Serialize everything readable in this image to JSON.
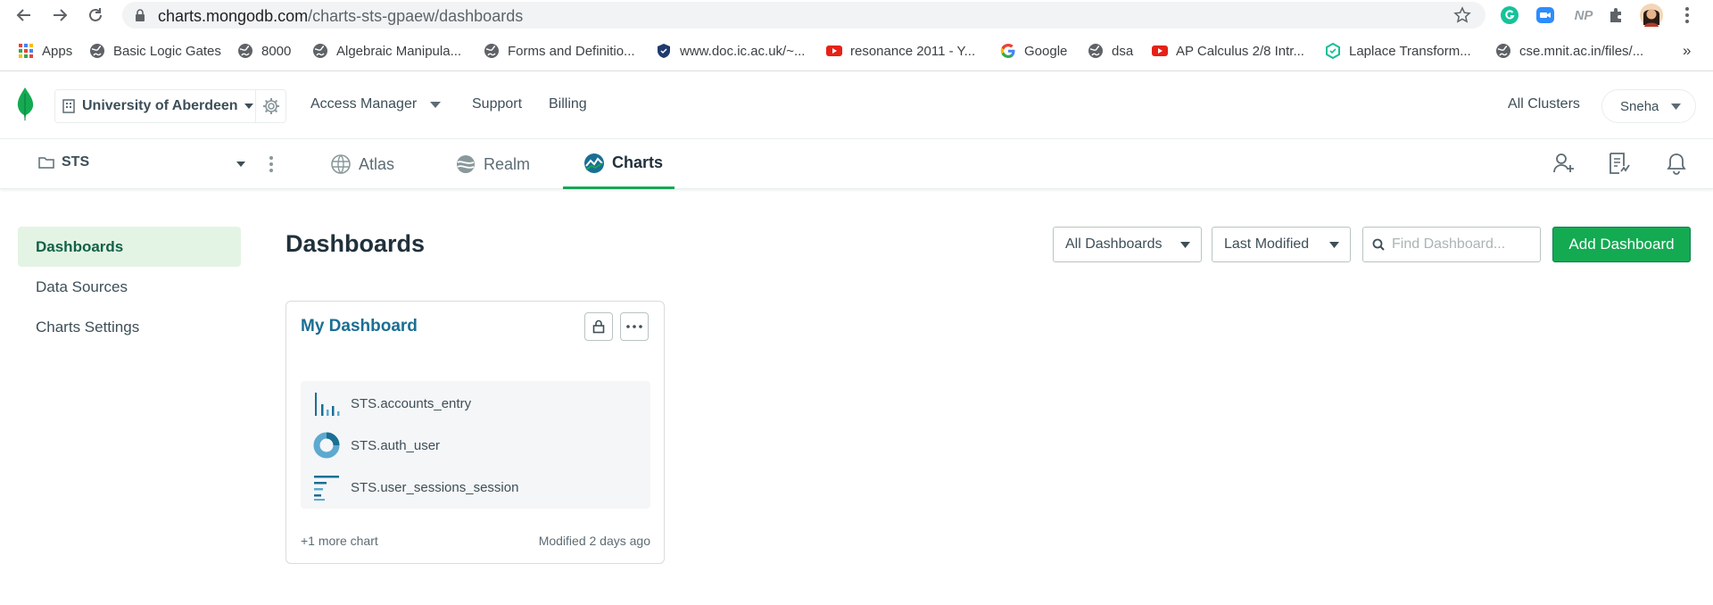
{
  "browser": {
    "url_host": "charts.mongodb.com",
    "url_path": "/charts-sts-gpaew/dashboards",
    "extension_np_label": "NP"
  },
  "bookmarks": {
    "apps": "Apps",
    "items": [
      {
        "label": "Basic Logic Gates",
        "icon": "globe-icon"
      },
      {
        "label": "8000",
        "icon": "globe-icon"
      },
      {
        "label": "Algebraic Manipula...",
        "icon": "globe-icon"
      },
      {
        "label": "Forms and Definitio...",
        "icon": "globe-icon"
      },
      {
        "label": "www.doc.ic.ac.uk/~...",
        "icon": "shield-icon"
      },
      {
        "label": "resonance 2011 - Y...",
        "icon": "youtube-icon"
      },
      {
        "label": "Google",
        "icon": "google-icon"
      },
      {
        "label": "dsa",
        "icon": "globe-icon"
      },
      {
        "label": "AP Calculus 2/8 Intr...",
        "icon": "youtube-icon"
      },
      {
        "label": "Laplace Transform...",
        "icon": "hexagon-icon"
      },
      {
        "label": "cse.mnit.ac.in/files/...",
        "icon": "globe-icon"
      }
    ],
    "overflow": "»"
  },
  "topbar": {
    "org_name": "University of Aberdeen",
    "access_manager": "Access Manager",
    "support": "Support",
    "billing": "Billing",
    "all_clusters": "All Clusters",
    "user": "Sneha"
  },
  "projectbar": {
    "project": "STS",
    "tabs": [
      {
        "label": "Atlas"
      },
      {
        "label": "Realm"
      },
      {
        "label": "Charts"
      }
    ]
  },
  "sidebar": {
    "items": [
      {
        "label": "Dashboards"
      },
      {
        "label": "Data Sources"
      },
      {
        "label": "Charts Settings"
      }
    ]
  },
  "main": {
    "title": "Dashboards",
    "filter_value": "All Dashboards",
    "sort_value": "Last Modified",
    "search_placeholder": "Find Dashboard...",
    "add_button": "Add Dashboard"
  },
  "card": {
    "title": "My Dashboard",
    "charts": [
      {
        "name": "STS.accounts_entry",
        "icon": "bar-chart-icon"
      },
      {
        "name": "STS.auth_user",
        "icon": "donut-chart-icon"
      },
      {
        "name": "STS.user_sessions_session",
        "icon": "horizontal-bar-chart-icon"
      }
    ],
    "more_charts": "+1 more chart",
    "modified": "Modified 2 days ago"
  },
  "colors": {
    "accent_green": "#13aa52",
    "active_nav_bg": "#e4f4e4",
    "link_blue": "#1a6f93",
    "chart_blue": "#1a6f93"
  }
}
